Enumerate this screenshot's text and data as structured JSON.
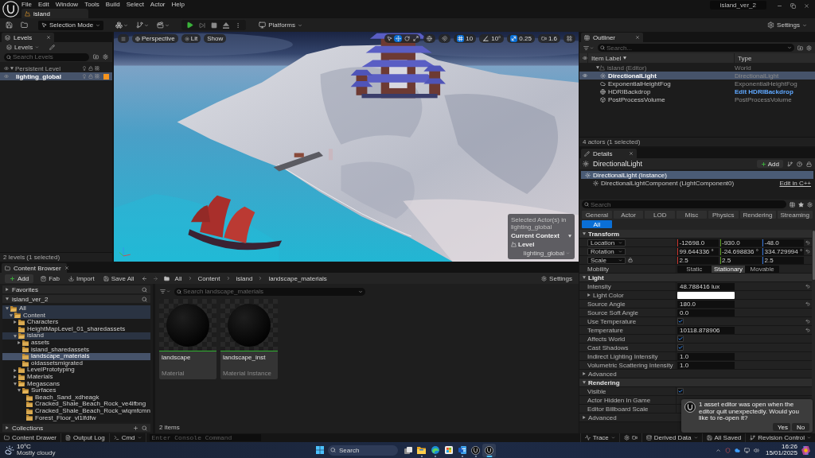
{
  "title_bar": {
    "menu": [
      "File",
      "Edit",
      "Window",
      "Tools",
      "Build",
      "Select",
      "Actor",
      "Help"
    ],
    "document_tab": "island",
    "project": "island_ver_2"
  },
  "toolbar": {
    "mode": "Selection Mode",
    "platforms": "Platforms",
    "settings": "Settings"
  },
  "levels": {
    "tab": "Levels",
    "menu_button": "Levels",
    "search": {
      "placeholder": "Search Levels"
    },
    "items": [
      {
        "label": "Persistent Level",
        "expanded": true,
        "selected": false,
        "children": [
          {
            "label": "lighting_global",
            "selected": true,
            "color": "#f7941d"
          }
        ]
      }
    ],
    "status": "2 levels (1 selected)"
  },
  "viewport": {
    "view_buttons": [
      {
        "kind": "perspective",
        "label": "Perspective"
      },
      {
        "kind": "lit",
        "label": "Lit"
      },
      {
        "kind": "show",
        "label": "Show"
      }
    ],
    "transform_tools": [
      {
        "kind": "select",
        "selected": false
      },
      {
        "kind": "translate",
        "selected": true
      },
      {
        "kind": "rotate",
        "selected": false
      },
      {
        "kind": "scale",
        "selected": false
      }
    ],
    "snaps": [
      {
        "kind": "grid",
        "value": "10",
        "on": true
      },
      {
        "kind": "angle",
        "value": "10°",
        "on": false
      },
      {
        "kind": "scale",
        "value": "0.25",
        "on": true
      }
    ],
    "camera_speed": "1.6",
    "context": {
      "caption": "Selected Actor(s) in lighting_global",
      "heading": "Current Context",
      "label": "Level",
      "value": "lighting_global"
    }
  },
  "outliner": {
    "tab": "Outliner",
    "search": {
      "placeholder": "Search..."
    },
    "columns": [
      "Item Label",
      "Type"
    ],
    "items": [
      {
        "kind": "world",
        "label": "island (Editor)",
        "type": "World",
        "expanded": true,
        "selected": false,
        "children": [
          {
            "kind": "light",
            "label": "DirectionalLight",
            "type": "DirectionalLight",
            "link": false,
            "selected": true
          },
          {
            "kind": "fog",
            "label": "ExponentialHeightFog",
            "type": "ExponentialHeightFog",
            "link": false,
            "selected": false
          },
          {
            "kind": "backdrop",
            "label": "HDRIBackdrop",
            "type": "Edit HDRIBackdrop",
            "link": true,
            "selected": false
          },
          {
            "kind": "volume",
            "label": "PostProcessVolume",
            "type": "PostProcessVolume",
            "link": false,
            "selected": false
          }
        ]
      }
    ],
    "status": "4 actors (1 selected)"
  },
  "details": {
    "tab": "Details",
    "actor": "DirectionalLight",
    "add_button": "Add",
    "components": [
      {
        "label": "DirectionalLight (Instance)",
        "selected": true,
        "children": [
          {
            "label": "DirectionalLightComponent (LightComponent0)",
            "selected": false,
            "action": "Edit in C++"
          }
        ]
      }
    ],
    "search": {
      "placeholder": "Search"
    },
    "filters": [
      {
        "label": "General",
        "selected": false
      },
      {
        "label": "Actor",
        "selected": false
      },
      {
        "label": "LOD",
        "selected": false
      },
      {
        "label": "Misc",
        "selected": false
      },
      {
        "label": "Physics",
        "selected": false
      },
      {
        "label": "Rendering",
        "selected": false
      },
      {
        "label": "Streaming",
        "selected": false
      },
      {
        "label": "All",
        "selected": true
      }
    ],
    "sections": [
      {
        "title": "Transform",
        "expanded": true,
        "rows": [
          {
            "kind": "vector",
            "label": "Location",
            "values": [
              "-12698.0",
              "-930.0",
              "-48.0"
            ],
            "reset": true
          },
          {
            "kind": "vector",
            "label": "Rotation",
            "values": [
              "99.644336 °",
              "-24.698836 °",
              "334.729994 °"
            ],
            "reset": true
          },
          {
            "kind": "vector",
            "label": "Scale",
            "values": [
              "2.5",
              "2.5",
              "2.5"
            ],
            "locked": true
          },
          {
            "kind": "segmented",
            "label": "Mobility",
            "options": [
              {
                "label": "Static",
                "selected": false
              },
              {
                "label": "Stationary",
                "selected": true
              },
              {
                "label": "Movable",
                "selected": false
              }
            ]
          }
        ]
      },
      {
        "title": "Light",
        "expanded": true,
        "rows": [
          {
            "kind": "number",
            "label": "Intensity",
            "value": "48.788416 lux",
            "reset": true
          },
          {
            "kind": "color",
            "label": "Light Color",
            "expanded": false,
            "color": "#ffffff"
          },
          {
            "kind": "number",
            "label": "Source Angle",
            "value": "180.0",
            "reset": true
          },
          {
            "kind": "number",
            "label": "Source Soft Angle",
            "value": "0.0"
          },
          {
            "kind": "checkbox",
            "label": "Use Temperature",
            "checked": true,
            "reset": true
          },
          {
            "kind": "number",
            "label": "Temperature",
            "value": "10118.878906",
            "reset": true
          },
          {
            "kind": "checkbox",
            "label": "Affects World",
            "checked": true
          },
          {
            "kind": "checkbox",
            "label": "Cast Shadows",
            "checked": true
          },
          {
            "kind": "number",
            "label": "Indirect Lighting Intensity",
            "value": "1.0"
          },
          {
            "kind": "number",
            "label": "Volumetric Scattering Intensity",
            "value": "1.0"
          },
          {
            "kind": "group",
            "label": "Advanced",
            "expanded": false
          }
        ]
      },
      {
        "title": "Rendering",
        "expanded": true,
        "rows": [
          {
            "kind": "checkbox",
            "label": "Visible",
            "checked": true
          },
          {
            "kind": "label",
            "label": "Actor Hidden In Game"
          },
          {
            "kind": "label",
            "label": "Editor Billboard Scale"
          },
          {
            "kind": "group",
            "label": "Advanced",
            "expanded": false
          }
        ]
      }
    ]
  },
  "notification": {
    "message": "1 asset editor was open when the editor quit unexpectedly. Would you like to re-open it?",
    "buttons": [
      "Yes",
      "No"
    ]
  },
  "content_browser": {
    "tab": "Content Browser",
    "actions": [
      {
        "kind": "add",
        "label": "Add"
      },
      {
        "kind": "fab",
        "label": "Fab"
      },
      {
        "kind": "import",
        "label": "Import"
      },
      {
        "kind": "save",
        "label": "Save All"
      }
    ],
    "path": [
      "All",
      "Content",
      "island",
      "landscape_materials"
    ],
    "settings": "Settings",
    "sources": [
      {
        "label": "Favorites",
        "expanded": false
      },
      {
        "label": "island_ver_2",
        "expanded": true
      }
    ],
    "tree": [
      {
        "label": "All",
        "expanded": true,
        "selected": false,
        "children": [
          {
            "label": "Content",
            "expanded": true,
            "selected": false,
            "children": [
              {
                "label": "Characters",
                "expanded": false,
                "selected": false
              },
              {
                "label": "HeightMapLevel_01_sharedassets",
                "selected": false
              },
              {
                "label": "island",
                "expanded": true,
                "selected": false,
                "children": [
                  {
                    "label": "assets",
                    "expanded": false,
                    "selected": false
                  },
                  {
                    "label": "island_sharedassets",
                    "selected": false
                  },
                  {
                    "label": "landscape_materials",
                    "selected": true
                  },
                  {
                    "label": "oldassetsmigrated",
                    "selected": false
                  }
                ]
              },
              {
                "label": "LevelPrototyping",
                "expanded": false,
                "selected": false
              },
              {
                "label": "Materials",
                "expanded": false,
                "selected": false
              },
              {
                "label": "Megascans",
                "expanded": true,
                "selected": false,
                "children": [
                  {
                    "label": "Surfaces",
                    "expanded": true,
                    "selected": false,
                    "children": [
                      {
                        "label": "Beach_Sand_xdheagk",
                        "selected": false
                      },
                      {
                        "label": "Cracked_Shale_Beach_Rock_ve4lfbng",
                        "selected": false
                      },
                      {
                        "label": "Cracked_Shale_Beach_Rock_wiqmfcmn",
                        "selected": false
                      },
                      {
                        "label": "Forest_Floor_vl1lfdfw",
                        "selected": false
                      }
                    ]
                  }
                ]
              }
            ]
          }
        ]
      }
    ],
    "collections": {
      "label": "Collections",
      "expanded": false
    },
    "search": {
      "placeholder": "Search landscape_materials"
    },
    "assets": [
      {
        "name": "landscape",
        "type": "Material"
      },
      {
        "name": "landscape_inst",
        "type": "Material Instance"
      }
    ],
    "count": "2 items"
  },
  "status_bar": {
    "items": [
      {
        "kind": "drawer",
        "label": "Content Drawer"
      },
      {
        "kind": "log",
        "label": "Output Log"
      },
      {
        "kind": "cmd",
        "label": "Cmd"
      }
    ],
    "console": {
      "placeholder": "Enter Console Command"
    },
    "right_items": [
      {
        "kind": "trace",
        "label": "Trace"
      },
      {
        "kind": "derived",
        "label": "Derived Data"
      },
      {
        "kind": "saved",
        "label": "All Saved"
      },
      {
        "kind": "revision",
        "label": "Revision Control"
      }
    ]
  },
  "taskbar": {
    "weather": {
      "temperature": "10°C",
      "condition": "Mostly cloudy"
    },
    "search": {
      "placeholder": "Search"
    },
    "apps": [
      {
        "kind": "task-view",
        "running": false,
        "active": false
      },
      {
        "kind": "files",
        "running": true,
        "active": false
      },
      {
        "kind": "browser",
        "running": true,
        "active": false
      },
      {
        "kind": "store",
        "running": false,
        "active": false
      },
      {
        "kind": "document",
        "running": true,
        "active": false
      },
      {
        "kind": "editor",
        "running": true,
        "active": false
      },
      {
        "kind": "editor",
        "running": true,
        "active": true
      }
    ],
    "clock": {
      "time": "16:26",
      "date": "15/01/2025"
    }
  }
}
